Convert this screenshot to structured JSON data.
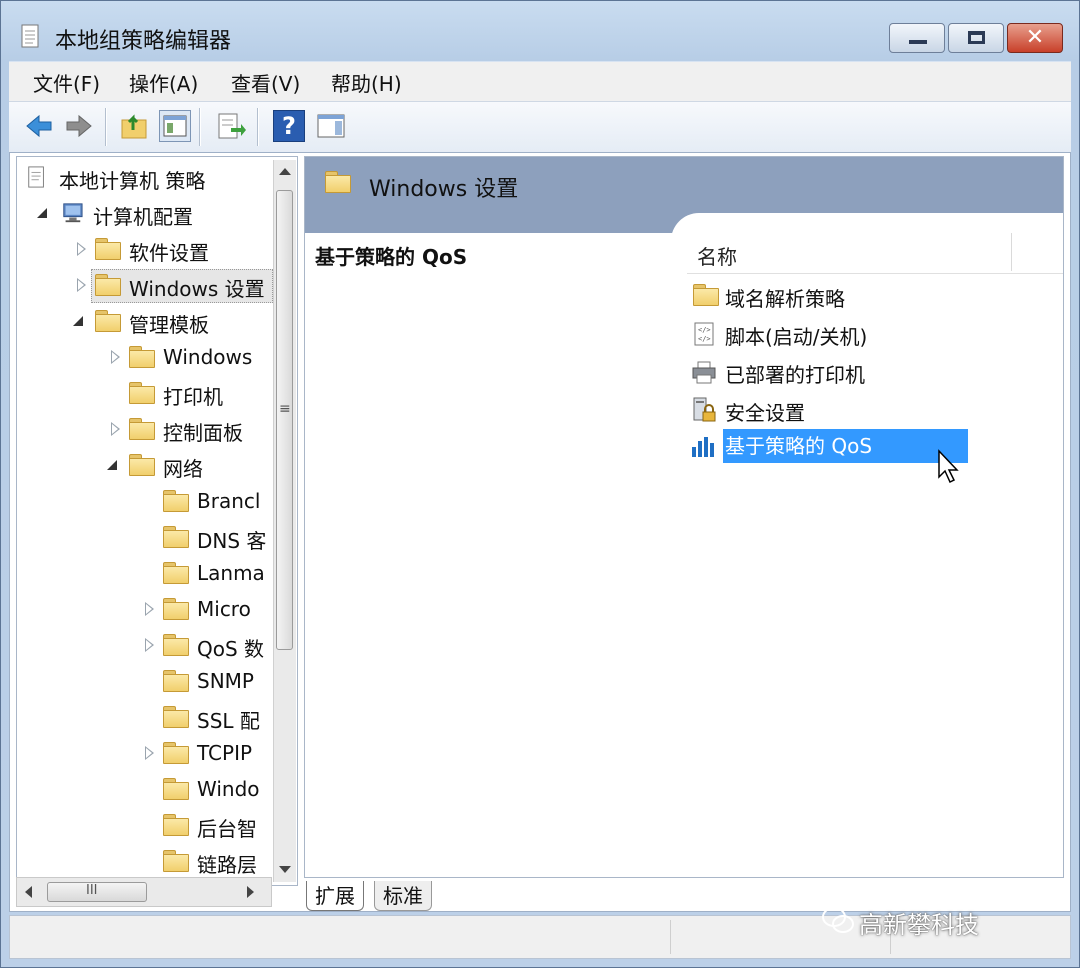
{
  "window": {
    "title": "本地组策略编辑器",
    "close_glyph": "✕"
  },
  "menu": [
    "文件(F)",
    "操作(A)",
    "查看(V)",
    "帮助(H)"
  ],
  "toolbar": {
    "buttons": [
      "back-arrow-icon",
      "forward-arrow-icon",
      "up-folder-icon",
      "show-hide-tree-icon",
      "export-list-icon",
      "help-icon",
      "show-action-pane-icon"
    ],
    "help_glyph": "?"
  },
  "tree": {
    "root": "本地计算机 策略",
    "computer_config": "计算机配置",
    "software_settings": "软件设置",
    "windows_settings": "Windows 设置",
    "admin_templates": "管理模板",
    "windows_components": "Windows",
    "printers": "打印机",
    "control_panel": "控制面板",
    "network": "网络",
    "network_children": [
      "Brancl",
      "DNS 客",
      "Lanma",
      "Micro",
      "QoS 数",
      "SNMP",
      "SSL 配",
      "TCPIP",
      "Windo",
      "后台智",
      "链路层"
    ],
    "scroll_glyph": "≡",
    "hscroll_glyph": "III"
  },
  "right": {
    "header_title": "Windows 设置",
    "description": "基于策略的 QoS",
    "column_name": "名称",
    "items": [
      "域名解析策略",
      "脚本(启动/关机)",
      "已部署的打印机",
      "安全设置",
      "基于策略的 QoS"
    ],
    "selected_index": 4
  },
  "tabs": [
    "扩展",
    "标准"
  ],
  "watermark": "高新攀科技",
  "colors": {
    "selection": "#3399ff",
    "header": "#8da0bd",
    "folder": "#f1cf6c"
  }
}
